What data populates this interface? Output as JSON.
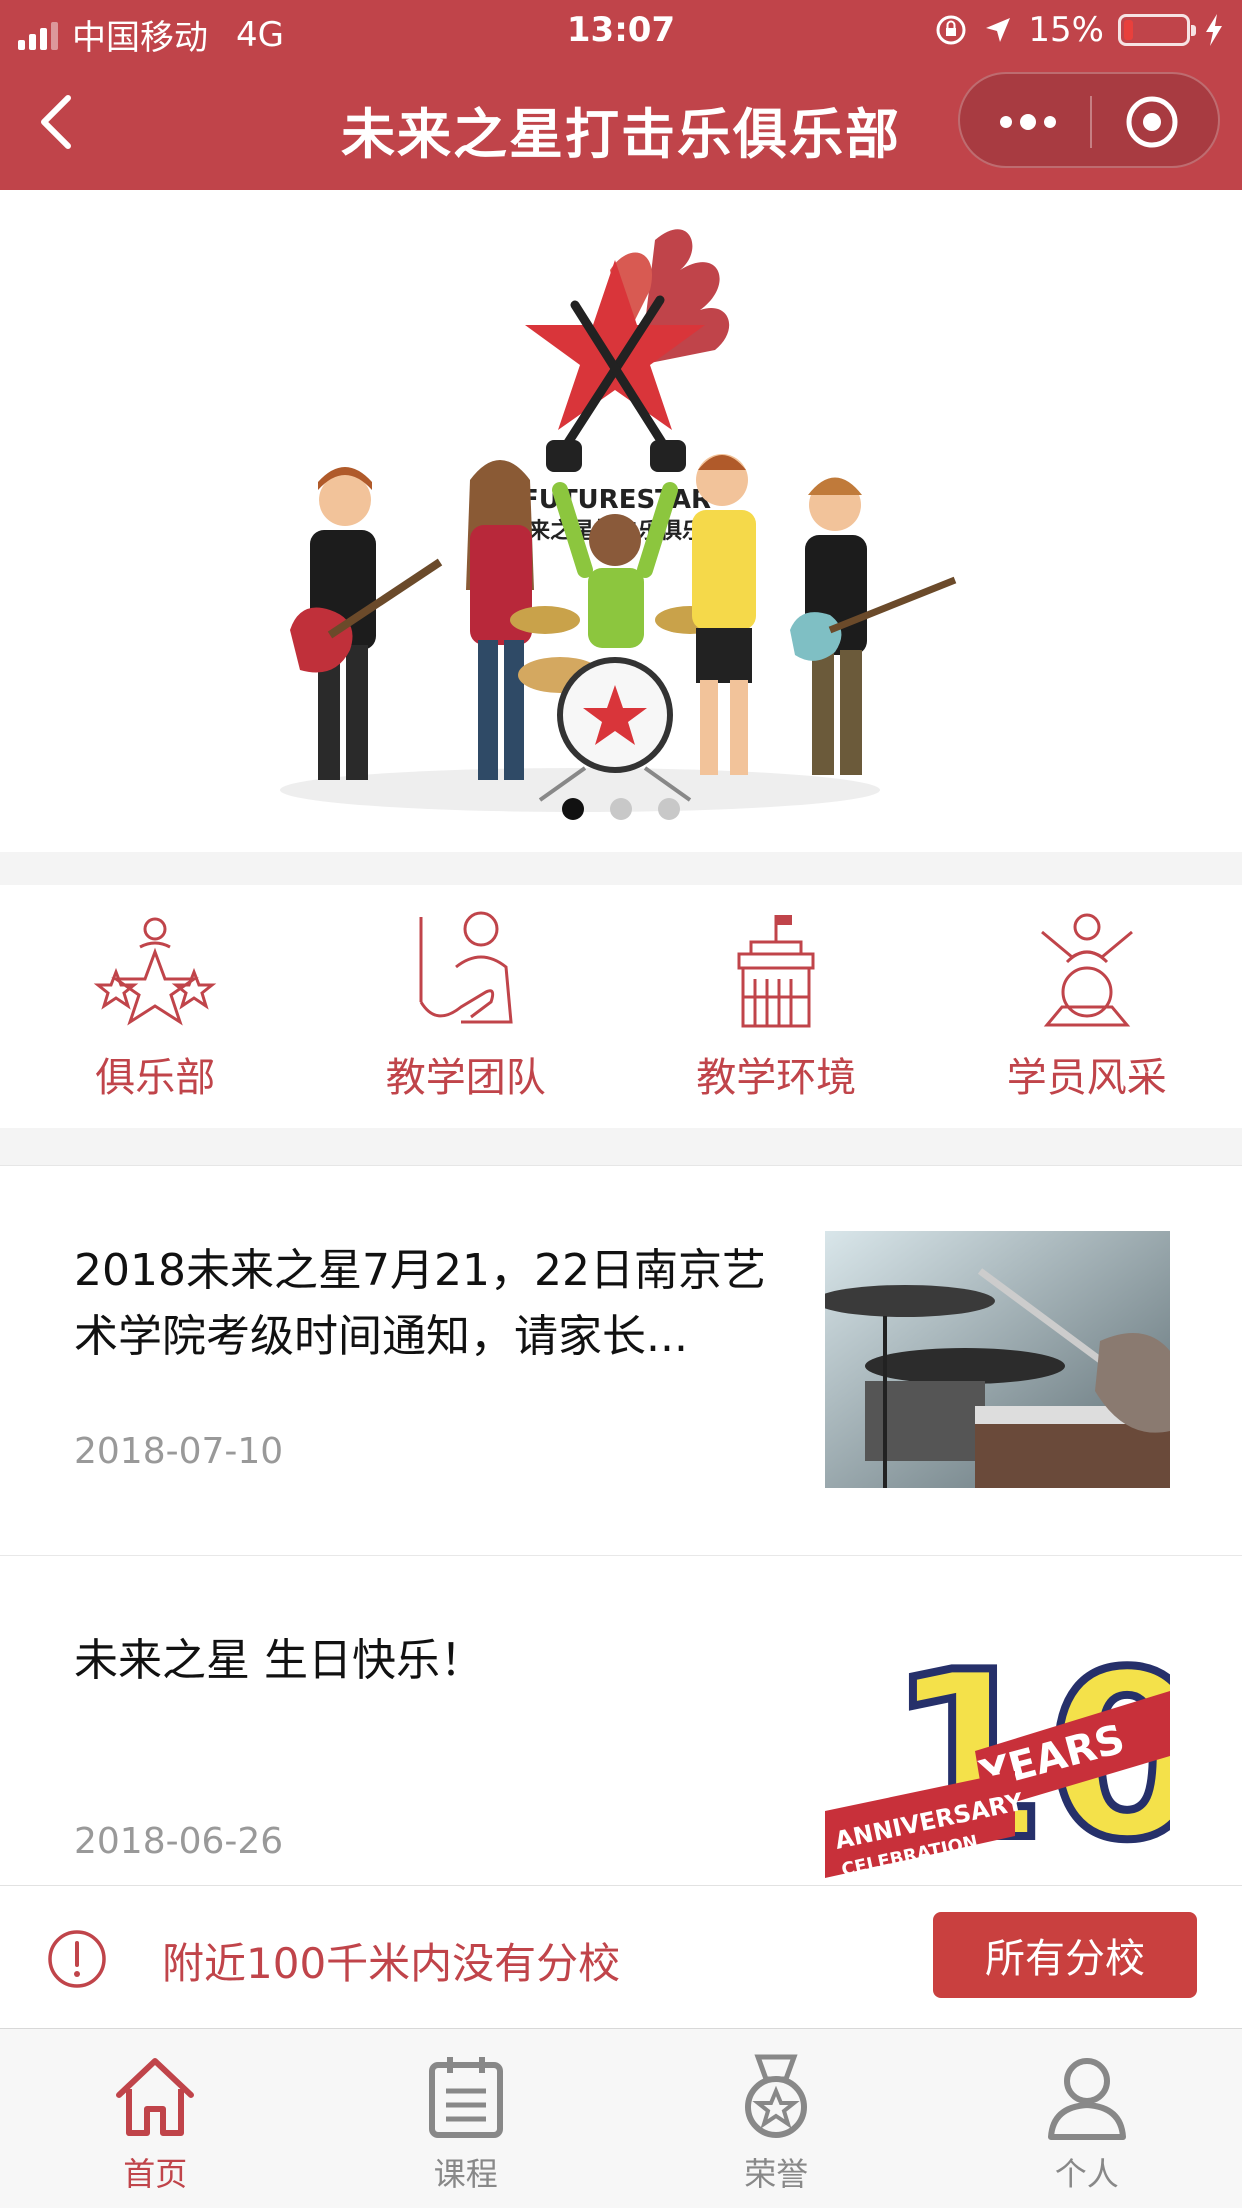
{
  "status_bar": {
    "carrier": "中国移动",
    "network": "4G",
    "time": "13:07",
    "battery": "15%",
    "battery_level": 0.15
  },
  "nav": {
    "title": "未来之星打击乐俱乐部"
  },
  "banner": {
    "logo_text_en": "FUTURESTAR",
    "logo_text_zh": "未来之星打击乐俱乐部",
    "slide_count": 3,
    "active_slide": 1
  },
  "categories": [
    {
      "label": "俱乐部",
      "icon": "club-stars-icon"
    },
    {
      "label": "教学团队",
      "icon": "teacher-icon"
    },
    {
      "label": "教学环境",
      "icon": "building-icon"
    },
    {
      "label": "学员风采",
      "icon": "drummer-icon"
    }
  ],
  "articles": [
    {
      "title": "2018未来之星7月21，22日南京艺术学院考级时间通知，请家长...",
      "date": "2018-07-10",
      "thumb": "drum-kit-photo"
    },
    {
      "title": "未来之星 生日快乐！",
      "date": "2018-06-26",
      "thumb": "anniversary-badge",
      "thumb_text": {
        "number": "10",
        "years": "YEARS",
        "anniversary": "ANNIVERSARY",
        "celebration": "CELEBRATION"
      }
    }
  ],
  "notice": {
    "text": "附近100千米内没有分校",
    "button": "所有分校"
  },
  "tabs": [
    {
      "label": "首页",
      "icon": "home-icon",
      "active": true
    },
    {
      "label": "课程",
      "icon": "calendar-icon",
      "active": false
    },
    {
      "label": "荣誉",
      "icon": "medal-icon",
      "active": false
    },
    {
      "label": "个人",
      "icon": "person-icon",
      "active": false
    }
  ],
  "colors": {
    "brand": "#c0444a",
    "button": "#c9403f",
    "muted": "#888888"
  }
}
